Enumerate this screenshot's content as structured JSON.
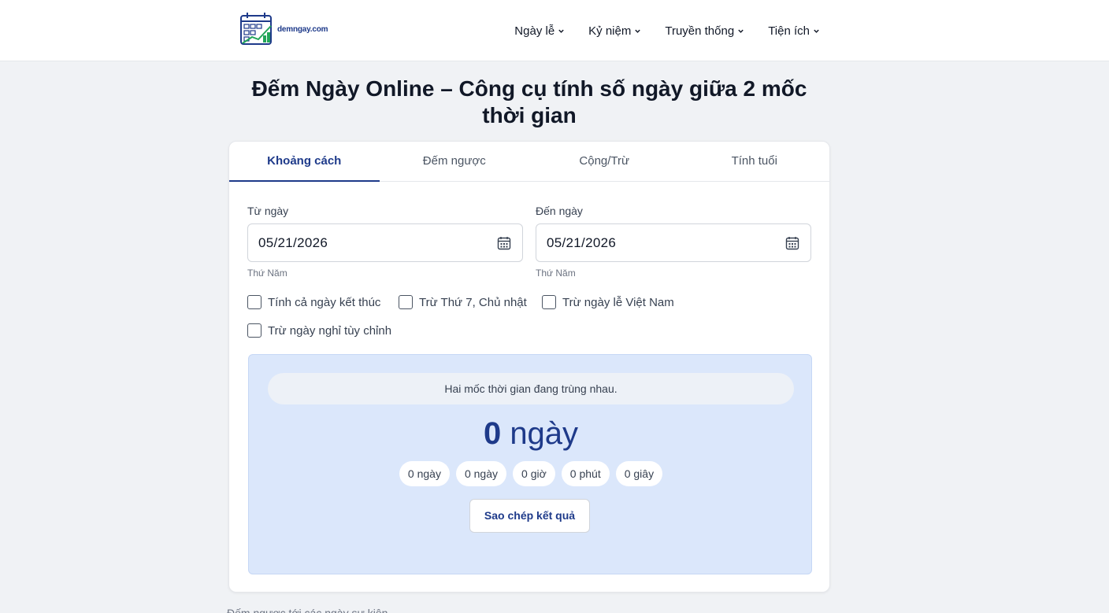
{
  "header": {
    "logo_text": "demngay.com",
    "nav": [
      {
        "label": "Ngày lễ"
      },
      {
        "label": "Kỷ niệm"
      },
      {
        "label": "Truyền thống"
      },
      {
        "label": "Tiện ích"
      }
    ]
  },
  "page_title": "Đếm Ngày Online – Công cụ tính số ngày giữa 2 mốc thời gian",
  "tabs": [
    {
      "label": "Khoảng cách",
      "active": true
    },
    {
      "label": "Đếm ngược",
      "active": false
    },
    {
      "label": "Cộng/Trừ",
      "active": false
    },
    {
      "label": "Tính tuổi",
      "active": false
    }
  ],
  "from": {
    "label": "Từ ngày",
    "value": "05/21/2026",
    "weekday": "Thứ Năm"
  },
  "to": {
    "label": "Đến ngày",
    "value": "05/21/2026",
    "weekday": "Thứ Năm"
  },
  "options": [
    {
      "label": "Tính cả ngày kết thúc",
      "checked": false
    },
    {
      "label": "Trừ Thứ 7, Chủ nhật",
      "checked": false
    },
    {
      "label": "Trừ ngày lễ Việt Nam",
      "checked": false
    },
    {
      "label": "Trừ ngày nghỉ tùy chỉnh",
      "checked": false
    }
  ],
  "result": {
    "notice": "Hai mốc thời gian đang trùng nhau.",
    "total_number": "0",
    "total_unit": "ngày",
    "breakdown": [
      "0 ngày",
      "0 ngày",
      "0 giờ",
      "0 phút",
      "0 giây"
    ],
    "copy_label": "Sao chép kết quả"
  },
  "colors": {
    "accent": "#1e3a8a",
    "result_bg": "#dbe7fb",
    "page_bg": "#f0f2f5"
  },
  "bottom_text": "Đếm ngược tới các ngày sự kiện"
}
